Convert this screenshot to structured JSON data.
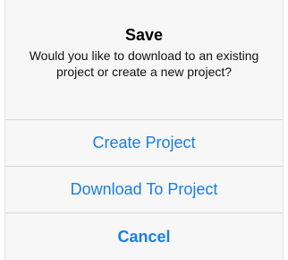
{
  "alert": {
    "title": "Save",
    "message": "Would you like to download to an existing project or create a new project?",
    "actions": [
      {
        "label": "Create Project"
      },
      {
        "label": "Download To Project"
      },
      {
        "label": "Cancel"
      }
    ],
    "accent_color": "#1a7ee6"
  }
}
